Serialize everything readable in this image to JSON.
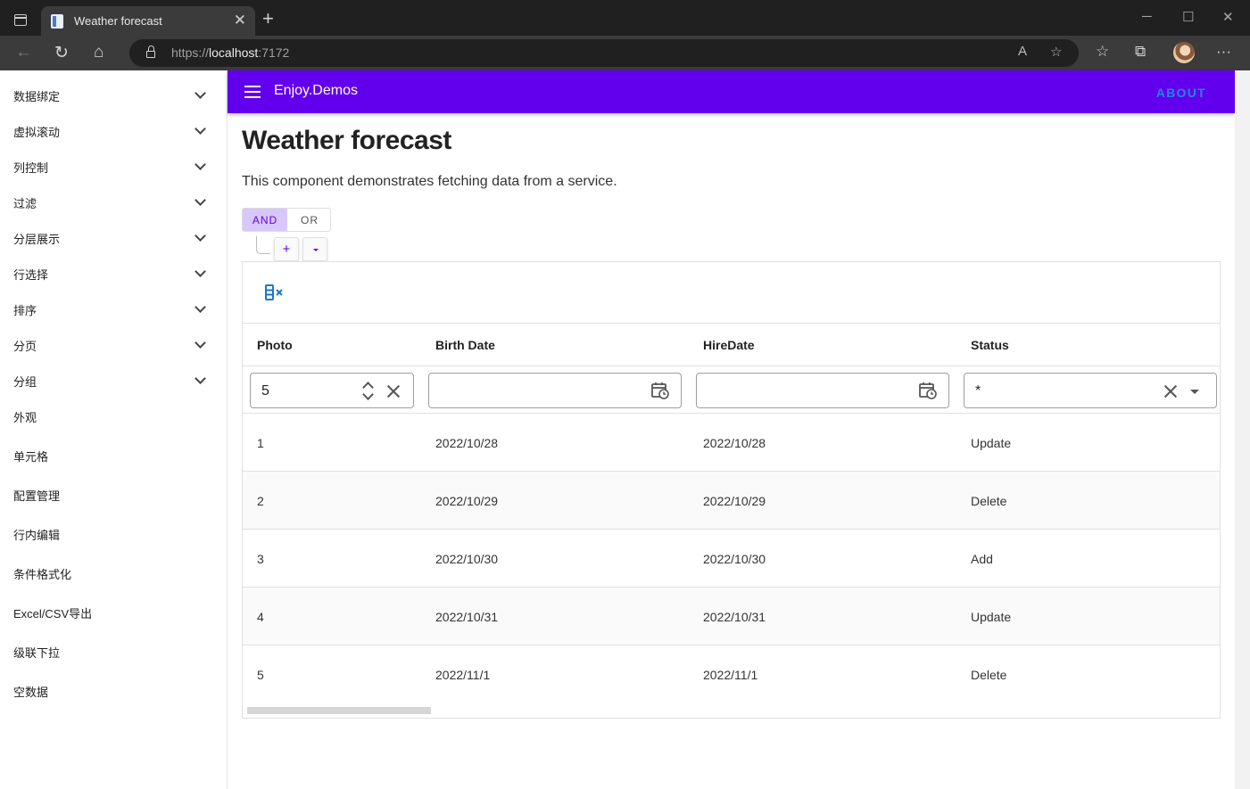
{
  "browser": {
    "tab_title": "Weather forecast",
    "url_scheme": "https://",
    "url_host": "localhost",
    "url_port": ":7172"
  },
  "appbar": {
    "brand": "Enjoy.Demos",
    "about": "ABOUT",
    "color": "#6200ee"
  },
  "sidebar": {
    "items": [
      {
        "label": "数据绑定",
        "expandable": true
      },
      {
        "label": "虚拟滚动",
        "expandable": true
      },
      {
        "label": "列控制",
        "expandable": true
      },
      {
        "label": "过滤",
        "expandable": true
      },
      {
        "label": "分层展示",
        "expandable": true
      },
      {
        "label": "行选择",
        "expandable": true
      },
      {
        "label": "排序",
        "expandable": true
      },
      {
        "label": "分页",
        "expandable": true
      },
      {
        "label": "分组",
        "expandable": true
      },
      {
        "label": "外观",
        "expandable": false
      },
      {
        "label": "单元格",
        "expandable": false
      },
      {
        "label": "配置管理",
        "expandable": false
      },
      {
        "label": "行内编辑",
        "expandable": false
      },
      {
        "label": "条件格式化",
        "expandable": false
      },
      {
        "label": "Excel/CSV导出",
        "expandable": false
      },
      {
        "label": "级联下拉",
        "expandable": false
      },
      {
        "label": "空数据",
        "expandable": false
      }
    ]
  },
  "main": {
    "title": "Weather forecast",
    "description": "This component demonstrates fetching data from a service.",
    "logic": {
      "and": "AND",
      "or": "OR",
      "selected": "AND"
    },
    "add_rule": "+"
  },
  "grid": {
    "columns": [
      "Photo",
      "Birth Date",
      "HireDate",
      "Status"
    ],
    "filters": {
      "photo": "5",
      "birth_date": "",
      "hire_date": "",
      "status": "*"
    },
    "rows": [
      [
        "1",
        "2022/10/28",
        "2022/10/28",
        "Update"
      ],
      [
        "2",
        "2022/10/29",
        "2022/10/29",
        "Delete"
      ],
      [
        "3",
        "2022/10/30",
        "2022/10/30",
        "Add"
      ],
      [
        "4",
        "2022/10/31",
        "2022/10/31",
        "Update"
      ],
      [
        "5",
        "2022/11/1",
        "2022/11/1",
        "Delete"
      ]
    ]
  }
}
